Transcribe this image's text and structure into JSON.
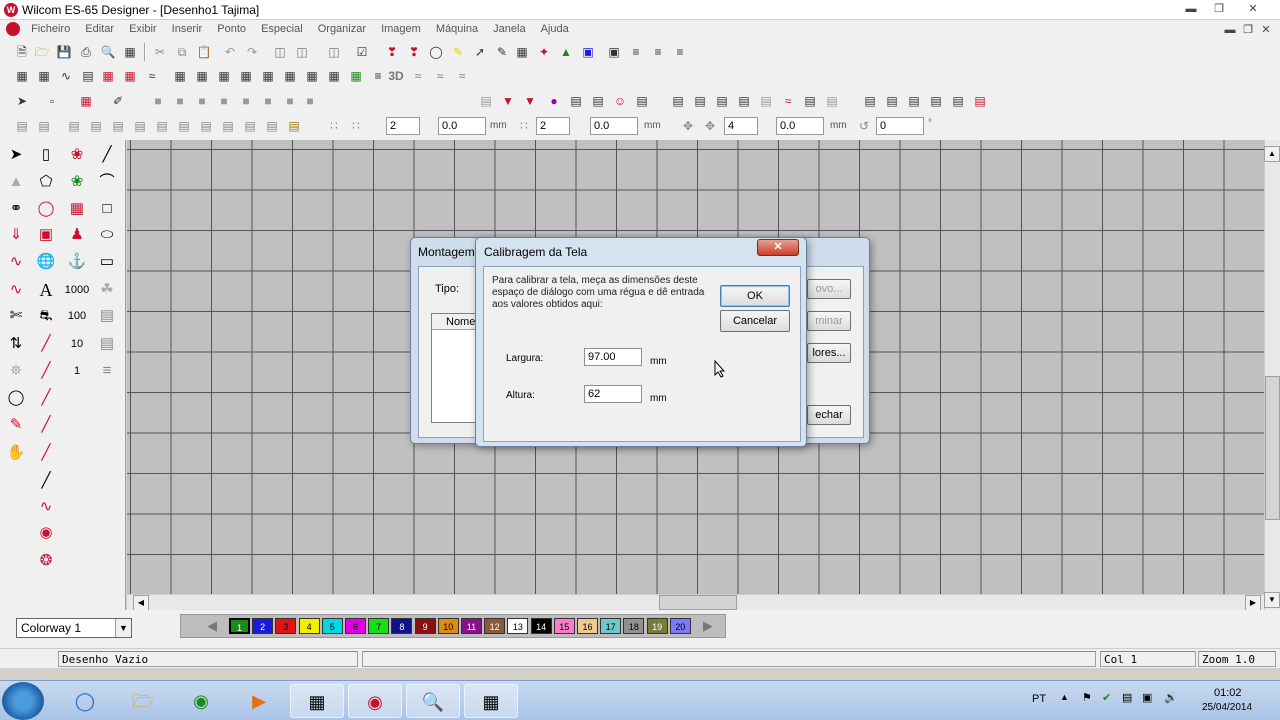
{
  "window": {
    "title": "Wilcom ES-65 Designer - [Desenho1        Tajima]"
  },
  "menu": [
    "Ficheiro",
    "Editar",
    "Exibir",
    "Inserir",
    "Ponto",
    "Especial",
    "Organizar",
    "Imagem",
    "Máquina",
    "Janela",
    "Ajuda"
  ],
  "toolbar4": {
    "spin1": "2",
    "spin2": "0.0",
    "unit2": "mm",
    "spin3": "2",
    "spin4": "0.0",
    "unit4": "mm",
    "spin5": "4",
    "spin6": "0.0",
    "unit6": "mm",
    "spin7": "0",
    "unit7": "°"
  },
  "toolbar2": {
    "label3d": "3D"
  },
  "lefttools": {
    "label_a": "A",
    "label_1000": "1000",
    "label_100": "100",
    "label_10": "10",
    "label_1": "1"
  },
  "colorway": {
    "value": "Colorway 1"
  },
  "palette": [
    {
      "n": "1",
      "c": "#1a8a1a"
    },
    {
      "n": "2",
      "c": "#1a1adb"
    },
    {
      "n": "3",
      "c": "#e01414"
    },
    {
      "n": "4",
      "c": "#f0f000"
    },
    {
      "n": "5",
      "c": "#00d8e0"
    },
    {
      "n": "6",
      "c": "#e000e0"
    },
    {
      "n": "7",
      "c": "#14e014"
    },
    {
      "n": "8",
      "c": "#10108a"
    },
    {
      "n": "9",
      "c": "#8a1010"
    },
    {
      "n": "10",
      "c": "#e08a10"
    },
    {
      "n": "11",
      "c": "#8a108a"
    },
    {
      "n": "12",
      "c": "#8a5a3a"
    },
    {
      "n": "13",
      "c": "#ffffff"
    },
    {
      "n": "14",
      "c": "#000000"
    },
    {
      "n": "15",
      "c": "#ff7ac8"
    },
    {
      "n": "16",
      "c": "#f0c890"
    },
    {
      "n": "17",
      "c": "#70c8c8"
    },
    {
      "n": "18",
      "c": "#909090"
    },
    {
      "n": "19",
      "c": "#7a7a3a"
    },
    {
      "n": "20",
      "c": "#7a7aff"
    }
  ],
  "status": {
    "left": "Desenho Vazio",
    "col": "Col 1",
    "zoom": "Zoom 1.0"
  },
  "dialog_back": {
    "title": "Montagem",
    "tipo_label": "Tipo:",
    "col_header": "Nome",
    "btn1": "ovo...",
    "btn2": "minar",
    "btn3": "lores...",
    "btn4": "echar"
  },
  "dialog_front": {
    "title": "Calibragem da Tela",
    "instructions": "Para calibrar a tela, meça as dimensões deste espaço de diálogo com uma régua e dê entrada aos valores obtidos aqui:",
    "ok": "OK",
    "cancel": "Cancelar",
    "width_label": "Largura:",
    "width_value": "97.00",
    "width_unit": "mm",
    "height_label": "Altura:",
    "height_value": "62",
    "height_unit": "mm"
  },
  "tray": {
    "lang": "PT",
    "time": "01:02",
    "date": "25/04/2014"
  }
}
